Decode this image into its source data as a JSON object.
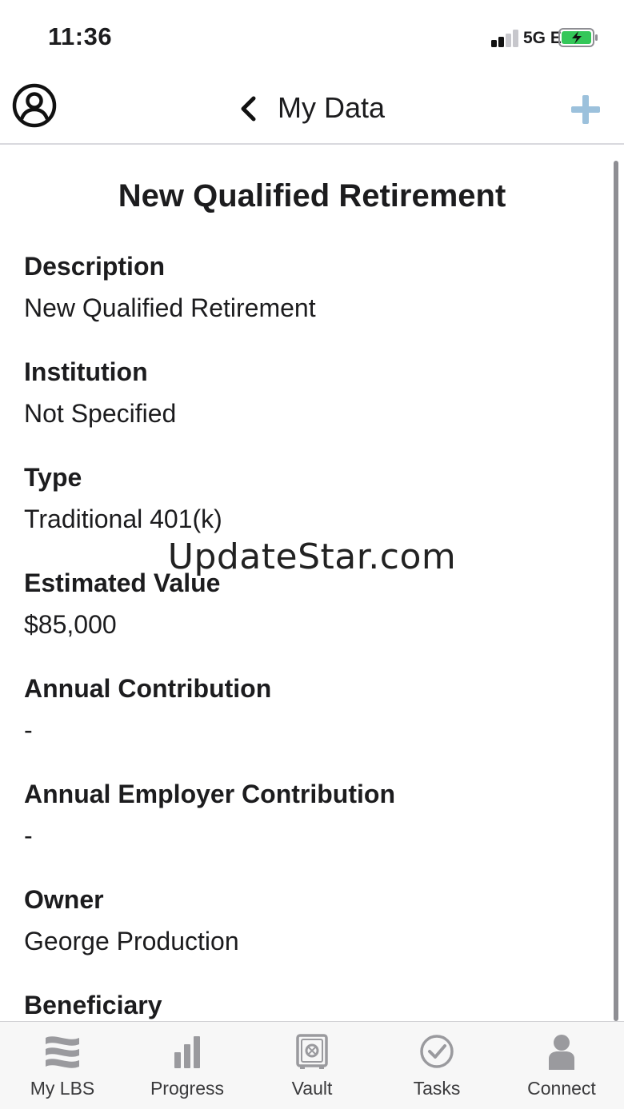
{
  "status_bar": {
    "time": "11:36",
    "network": "5G E"
  },
  "nav": {
    "title": "My Data",
    "profile_icon": "profile-icon",
    "back_icon": "chevron-left-icon",
    "add_icon": "plus-icon",
    "accent_color": "#9cc1dc"
  },
  "detail": {
    "title": "New Qualified Retirement",
    "fields": [
      {
        "label": "Description",
        "value": "New Qualified Retirement"
      },
      {
        "label": "Institution",
        "value": "Not Specified"
      },
      {
        "label": "Type",
        "value": "Traditional 401(k)"
      },
      {
        "label": "Estimated Value",
        "value": "$85,000"
      },
      {
        "label": "Annual Contribution",
        "value": "-"
      },
      {
        "label": "Annual Employer Contribution",
        "value": "-"
      },
      {
        "label": "Owner",
        "value": "George Production"
      },
      {
        "label": "Beneficiary",
        "value": ""
      }
    ]
  },
  "watermark": "UpdateStar.com",
  "tabs": [
    {
      "label": "My LBS",
      "icon": "waves-icon"
    },
    {
      "label": "Progress",
      "icon": "bar-chart-icon"
    },
    {
      "label": "Vault",
      "icon": "vault-icon"
    },
    {
      "label": "Tasks",
      "icon": "check-circle-icon"
    },
    {
      "label": "Connect",
      "icon": "person-icon"
    }
  ],
  "colors": {
    "tab_icon": "#9a9a9e",
    "battery": "#34c759"
  }
}
